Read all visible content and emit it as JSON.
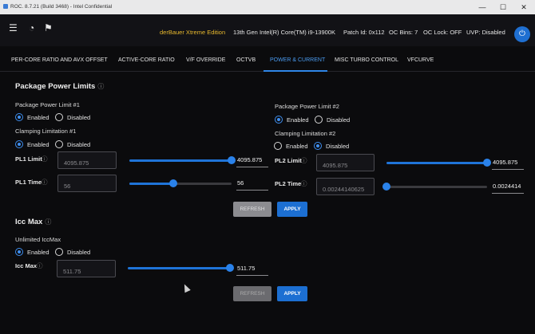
{
  "window": {
    "title": "ROC. 8.7.21 (Build 3468)  -  Intel Confidential",
    "minimize": "—",
    "maximize": "☐",
    "close": "✕"
  },
  "topbar": {
    "icons": [
      "menu-icon",
      "gauge-icon",
      "flag-icon",
      "power-icon"
    ],
    "brand": "derBauer Xtreme Edition",
    "cpu": "13th Gen Intel(R) Core(TM) i9-13900K",
    "patch": "Patch Id: 0x112",
    "oc_bins": "OC Bins: 7",
    "oc_lock": "OC Lock: OFF",
    "uvp": "UVP: Disabled",
    "menu_glyph": "☰",
    "gauge_glyph": "◔",
    "flag_glyph": "⚑",
    "power_glyph": "⏻"
  },
  "tabs": [
    {
      "label": "PER-CORE RATIO AND AVX OFFSET"
    },
    {
      "label": "ACTIVE-CORE RATIO"
    },
    {
      "label": "V/F OVERRIDE"
    },
    {
      "label": "OCTVB"
    },
    {
      "label": "POWER & CURRENT",
      "active": true
    },
    {
      "label": "MISC TURBO CONTROL"
    },
    {
      "label": "VFCURVE"
    }
  ],
  "package_power": {
    "title": "Package Power Limits",
    "info": "ⓘ",
    "pl1_group": {
      "label": "Package Power Limit #1",
      "enabled": "Enabled",
      "disabled": "Disabled",
      "selected": "Enabled",
      "clamping_label": "Clamping Limitation #1",
      "clamping_selected": "Enabled"
    },
    "pl2_group": {
      "label": "Package Power Limit #2",
      "enabled": "Enabled",
      "disabled": "Disabled",
      "selected": "Enabled",
      "clamping_label": "Clamping Limitation #2",
      "clamping_selected": "Disabled"
    },
    "pl1_limit": {
      "label": "PL1 Limit",
      "input": "4095.875",
      "value": "4095.875",
      "fill": 1.0
    },
    "pl1_time": {
      "label": "PL1 Time",
      "input": "56",
      "value": "56",
      "fill": 0.43
    },
    "pl2_limit": {
      "label": "PL2 Limit",
      "input": "4095.875",
      "value": "4095.875",
      "fill": 1.0
    },
    "pl2_time": {
      "label": "PL2 Time",
      "input": "0.00244140625",
      "value": "0.0024414",
      "fill": 0.0
    },
    "refresh": "REFRESH",
    "apply": "APPLY"
  },
  "icc_max": {
    "title": "Icc Max",
    "info": "ⓘ",
    "unlimited_label": "Unlimited IccMax",
    "enabled": "Enabled",
    "disabled": "Disabled",
    "selected": "Enabled",
    "icc_label": "Icc Max",
    "input": "511.75",
    "value": "511.75",
    "fill": 1.0,
    "refresh": "REFRESH",
    "apply": "APPLY"
  }
}
